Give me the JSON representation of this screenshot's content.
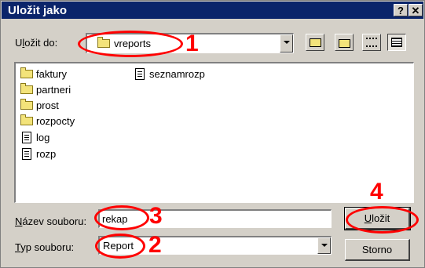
{
  "window": {
    "title": "Uložit jako",
    "help_button": "?",
    "close_button": "✕"
  },
  "save_in": {
    "label_prefix": "U",
    "label_u": "l",
    "label_suffix": "ožit do:",
    "value": "vreports"
  },
  "files": [
    {
      "name": "faktury",
      "type": "folder"
    },
    {
      "name": "partneri",
      "type": "folder"
    },
    {
      "name": "prost",
      "type": "folder"
    },
    {
      "name": "rozpocty",
      "type": "folder"
    },
    {
      "name": "log",
      "type": "file"
    },
    {
      "name": "rozp",
      "type": "file"
    },
    {
      "name": "seznamrozp",
      "type": "file"
    }
  ],
  "filename": {
    "label_u": "N",
    "label_rest": "ázev souboru:",
    "value": "rekap"
  },
  "filetype": {
    "label_u": "T",
    "label_rest": "yp souboru:",
    "value": "Report"
  },
  "buttons": {
    "save_u": "U",
    "save_rest": "ložit",
    "cancel": "Storno"
  },
  "annotations": {
    "n1": "1",
    "n2": "2",
    "n3": "3",
    "n4": "4"
  },
  "colors": {
    "annotation": "#ff0000",
    "titlebar": "#0a246a",
    "face": "#d4d0c8"
  }
}
